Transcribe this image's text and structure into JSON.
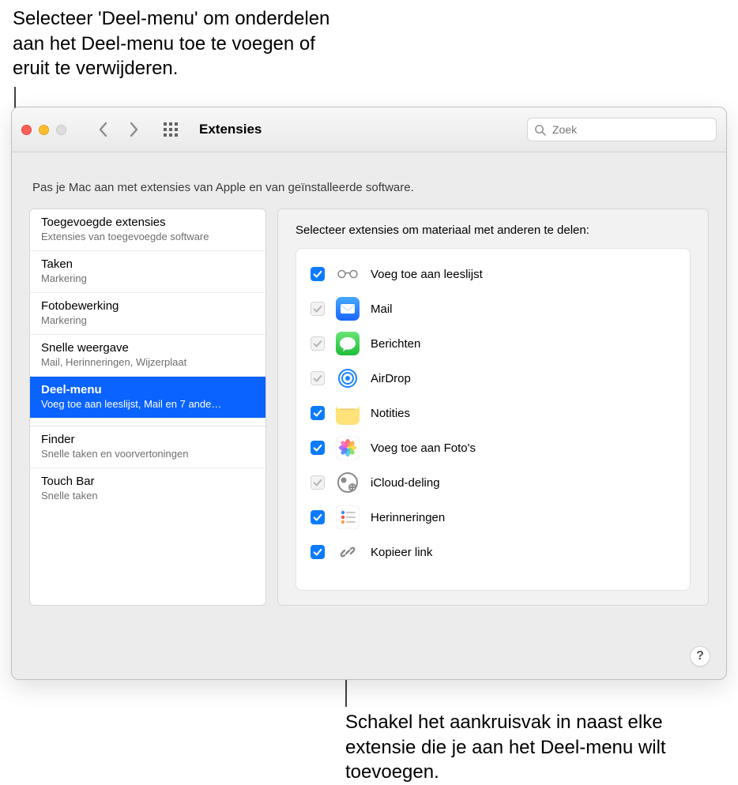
{
  "callouts": {
    "top": "Selecteer 'Deel-menu' om onderdelen aan het Deel-menu toe te voegen of eruit te verwijderen.",
    "bottom": "Schakel het aankruisvak in naast elke extensie die je aan het Deel-menu wilt toevoegen."
  },
  "window": {
    "title": "Extensies",
    "search_placeholder": "Zoek",
    "intro": "Pas je Mac aan met extensies van Apple en van geïnstalleerde software.",
    "help_label": "?"
  },
  "sidebar": {
    "items": [
      {
        "title": "Toegevoegde extensies",
        "sub": "Extensies van toegevoegde software",
        "selected": false
      },
      {
        "title": "Taken",
        "sub": "Markering",
        "selected": false
      },
      {
        "title": "Fotobewerking",
        "sub": "Markering",
        "selected": false
      },
      {
        "title": "Snelle weergave",
        "sub": "Mail, Herinneringen, Wijzerplaat",
        "selected": false
      },
      {
        "title": "Deel-menu",
        "sub": "Voeg toe aan leeslijst, Mail en 7 ande…",
        "selected": true
      },
      {
        "title": "Finder",
        "sub": "Snelle taken en voorvertoningen",
        "selected": false
      },
      {
        "title": "Touch Bar",
        "sub": "Snelle taken",
        "selected": false
      }
    ]
  },
  "main": {
    "header": "Selecteer extensies om materiaal met anderen te delen:",
    "items": [
      {
        "label": "Voeg toe aan leeslijst",
        "state": "on",
        "icon": "glasses"
      },
      {
        "label": "Mail",
        "state": "locked",
        "icon": "mail"
      },
      {
        "label": "Berichten",
        "state": "locked",
        "icon": "messages"
      },
      {
        "label": "AirDrop",
        "state": "locked",
        "icon": "airdrop"
      },
      {
        "label": "Notities",
        "state": "on",
        "icon": "notes"
      },
      {
        "label": "Voeg toe aan Foto's",
        "state": "on",
        "icon": "photos"
      },
      {
        "label": "iCloud-deling",
        "state": "locked",
        "icon": "icloud"
      },
      {
        "label": "Herinneringen",
        "state": "on",
        "icon": "reminders"
      },
      {
        "label": "Kopieer link",
        "state": "on",
        "icon": "link"
      }
    ]
  }
}
